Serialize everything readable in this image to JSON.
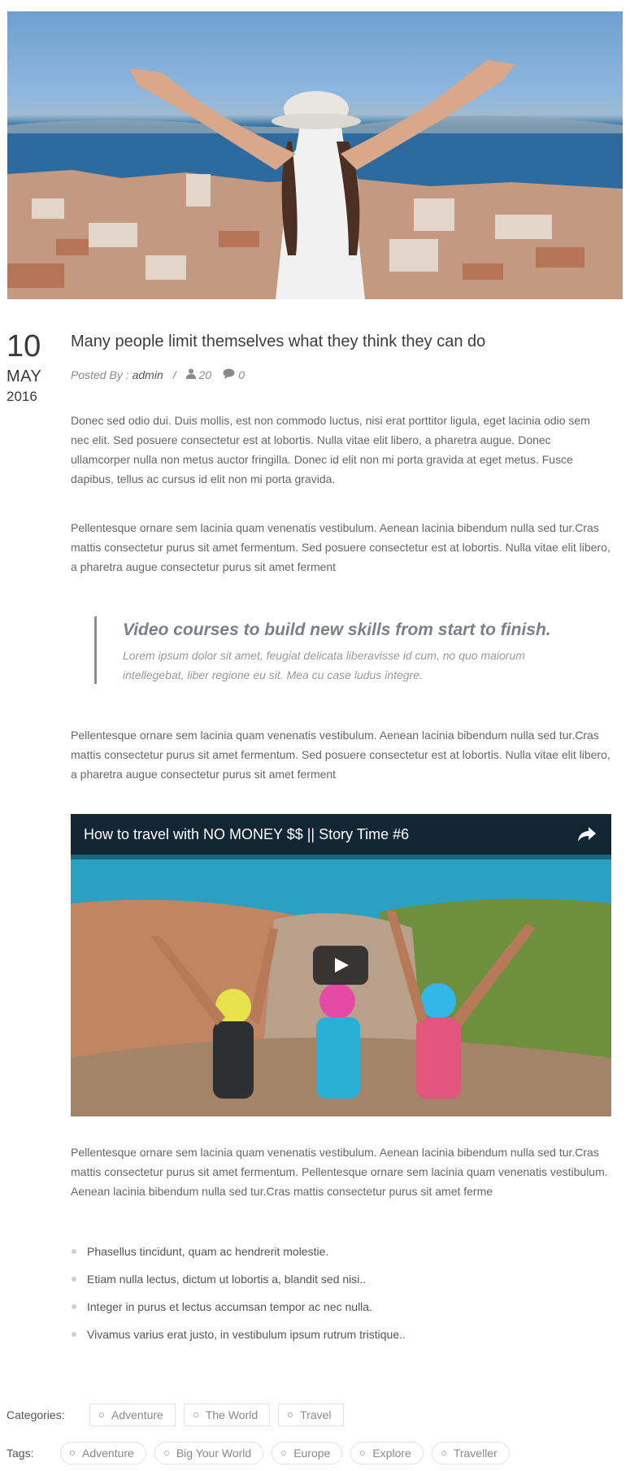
{
  "post": {
    "date": {
      "day": "10",
      "month": "MAY",
      "year": "2016"
    },
    "title": "Many people limit themselves what they think they can do",
    "meta": {
      "posted_by_label": "Posted By :",
      "author": "admin",
      "separator": "/",
      "views": "20",
      "comments": "0"
    },
    "paragraphs": [
      "Donec sed odio dui. Duis mollis, est non commodo luctus, nisi erat porttitor ligula, eget lacinia odio sem nec elit. Sed posuere consectetur est at lobortis. Nulla vitae elit libero, a pharetra augue. Donec ullamcorper nulla non metus auctor fringilla. Donec id elit non mi porta gravida at eget metus. Fusce dapibus, tellus ac cursus id elit non mi porta gravida.",
      "Pellentesque ornare sem lacinia quam venenatis vestibulum. Aenean lacinia bibendum nulla sed tur.Cras mattis consectetur purus sit amet fermentum. Sed posuere consectetur est at lobortis. Nulla vitae elit libero, a pharetra augue consectetur purus sit amet ferment",
      "Pellentesque ornare sem lacinia quam venenatis vestibulum. Aenean lacinia bibendum nulla sed tur.Cras mattis consectetur purus sit amet fermentum. Sed posuere consectetur est at lobortis. Nulla vitae elit libero, a pharetra augue consectetur purus sit amet ferment",
      "Pellentesque ornare sem lacinia quam venenatis vestibulum. Aenean lacinia bibendum nulla sed tur.Cras mattis consectetur purus sit amet fermentum. Pellentesque ornare sem lacinia quam venenatis vestibulum. Aenean lacinia bibendum nulla sed tur.Cras mattis consectetur purus sit amet ferme"
    ],
    "quote": {
      "heading": "Video courses to build new skills from start to finish.",
      "body": "Lorem ipsum dolor sit amet, feugiat delicata liberavisse id cum, no quo maiorum intellegebat, liber regione eu sit. Mea cu case ludus integre."
    },
    "video": {
      "title": "How to travel with NO MONEY $$ || Story Time #6",
      "share_icon": "share-arrow-icon",
      "play_icon": "play-icon"
    },
    "bullets": [
      "Phasellus tincidunt, quam ac hendrerit molestie.",
      "Etiam nulla lectus, dictum ut lobortis a, blandit sed nisi..",
      "Integer in purus et lectus accumsan tempor ac nec nulla.",
      "Vivamus varius erat justo, in vestibulum ipsum rutrum tristique.."
    ],
    "categories": {
      "label": "Categories:",
      "items": [
        "Adventure",
        "The World",
        "Travel"
      ]
    },
    "tags": {
      "label": "Tags:",
      "items": [
        "Adventure",
        "Big Your World",
        "Europe",
        "Explore",
        "Traveller"
      ]
    }
  },
  "icons": {
    "views": "user-icon",
    "comments": "comment-icon"
  },
  "colors": {
    "text": "#666666",
    "heading": "#3c3c3c",
    "quote_heading": "#7b8088",
    "chip_border": "#e3e3e3"
  }
}
